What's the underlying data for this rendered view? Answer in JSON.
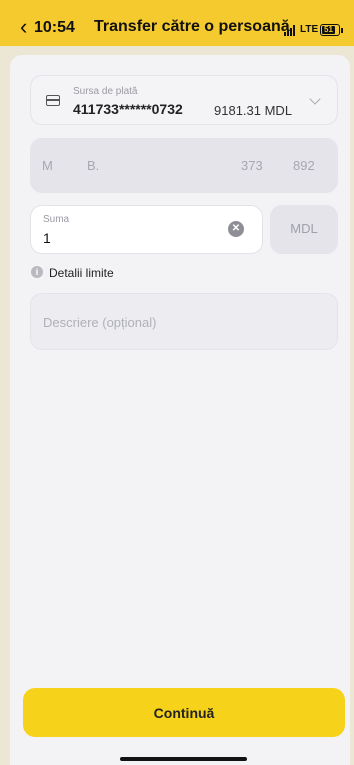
{
  "status_bar": {
    "time": "10:54",
    "network": "LTE",
    "battery": "51"
  },
  "header": {
    "title": "Transfer către o persoană"
  },
  "payment_source": {
    "label": "Sursa de plată",
    "card_number": "411733******0732",
    "balance": "9181.31 MDL"
  },
  "recipient": {
    "first": "M",
    "last": "B.",
    "code": "373",
    "phone_suffix": "892"
  },
  "amount": {
    "label": "Suma",
    "value": "1",
    "currency": "MDL"
  },
  "limits_link": "Detalii limite",
  "description": {
    "placeholder": "Descriere (opțional)"
  },
  "continue_label": "Continuă",
  "colors": {
    "brand_yellow": "#f6d31a",
    "status_yellow": "#f4ca2e",
    "background": "#f3f3f6"
  }
}
